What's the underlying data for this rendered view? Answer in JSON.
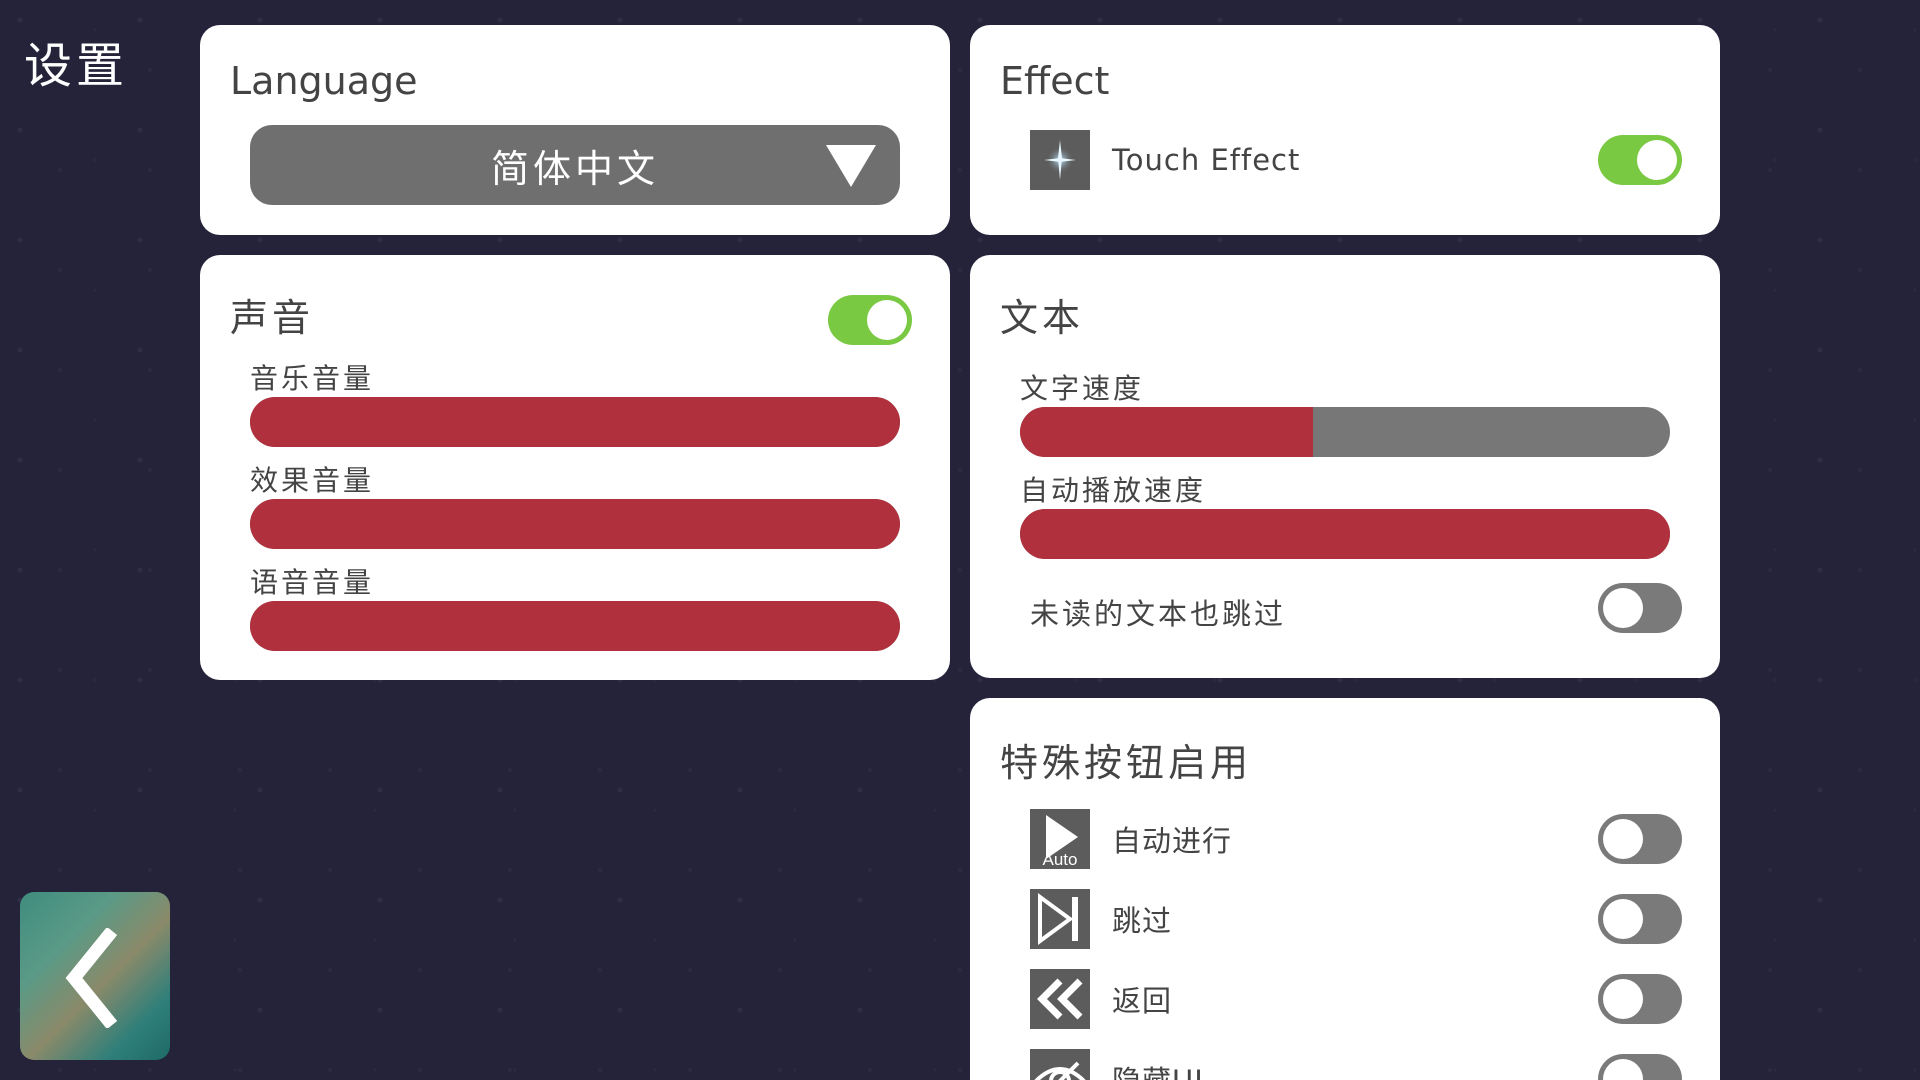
{
  "page": {
    "title": "设置"
  },
  "language": {
    "heading": "Language",
    "selected": "简体中文",
    "icon": "dropdown-triangle-icon"
  },
  "effect": {
    "heading": "Effect",
    "items": [
      {
        "label": "Touch Effect",
        "icon": "sparkle-icon",
        "enabled": true
      }
    ]
  },
  "sound": {
    "heading": "声音",
    "enabled": true,
    "sliders": [
      {
        "label": "音乐音量",
        "value": 1.0
      },
      {
        "label": "效果音量",
        "value": 1.0
      },
      {
        "label": "语音音量",
        "value": 1.0
      }
    ]
  },
  "text": {
    "heading": "文本",
    "sliders": [
      {
        "label": "文字速度",
        "value": 0.45
      },
      {
        "label": "自动播放速度",
        "value": 1.0
      }
    ],
    "skip_unread": {
      "label": "未读的文本也跳过",
      "enabled": false
    }
  },
  "special_buttons": {
    "heading": "特殊按钮启用",
    "items": [
      {
        "label": "自动进行",
        "icon": "auto-play-icon",
        "icon_text": "Auto",
        "enabled": false
      },
      {
        "label": "跳过",
        "icon": "skip-icon",
        "enabled": false
      },
      {
        "label": "返回",
        "icon": "rewind-icon",
        "enabled": false
      },
      {
        "label": "隐藏UI",
        "icon": "hide-ui-icon",
        "enabled": false
      }
    ]
  },
  "back_button": {
    "icon": "chevron-left-icon"
  },
  "colors": {
    "slider_fill": "#b0313d",
    "slider_track": "#777777",
    "toggle_on": "#7ac943",
    "toggle_off": "#7a7a7a",
    "background": "#24233a"
  }
}
